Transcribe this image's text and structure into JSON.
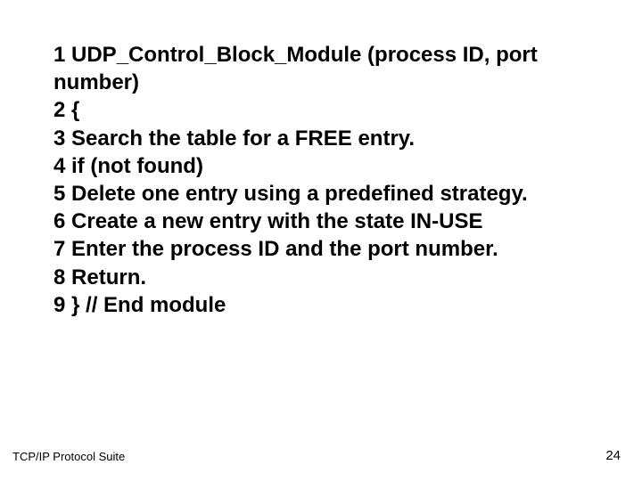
{
  "body": {
    "lines": [
      "1 UDP_Control_Block_Module (process ID, port number)",
      "2 {",
      "3 Search the table for a FREE entry.",
      "4 if (not found)",
      "5 Delete one entry using a predefined strategy.",
      "6 Create a new entry with the state IN-USE",
      "7 Enter the process ID and the port number.",
      "8 Return.",
      "9 } // End module"
    ]
  },
  "footer": {
    "left": "TCP/IP Protocol Suite",
    "right": "24"
  }
}
